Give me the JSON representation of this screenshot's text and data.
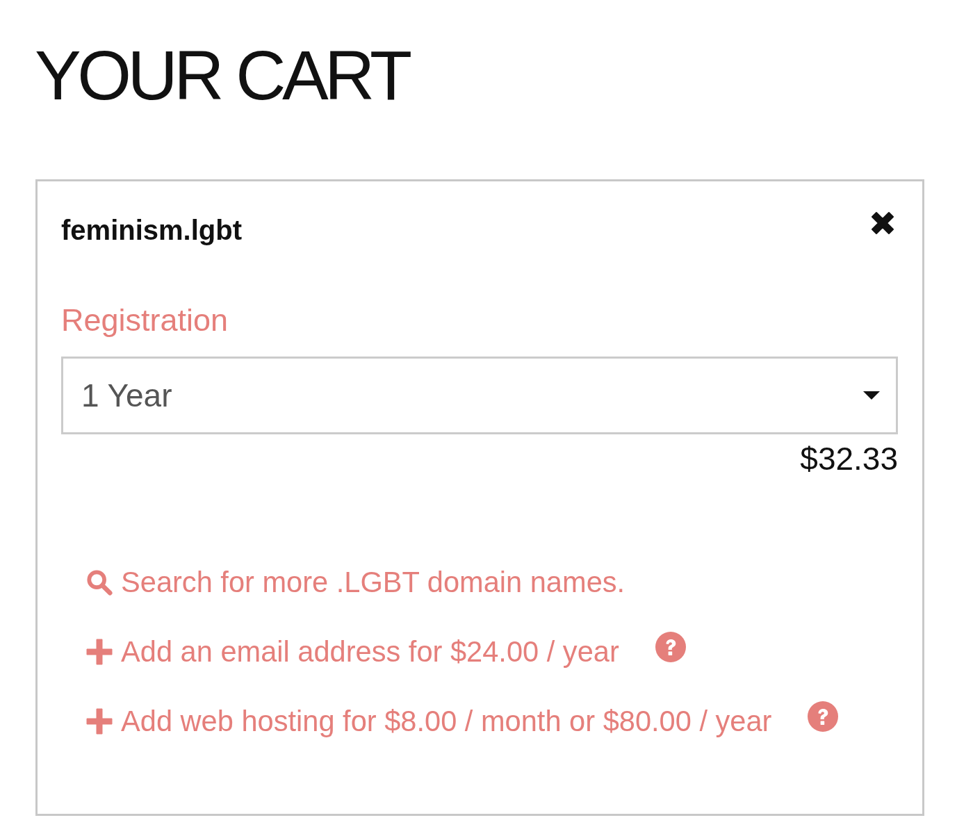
{
  "page": {
    "title": "YOUR CART"
  },
  "cart_item": {
    "domain": "feminism.lgbt",
    "registration_label": "Registration",
    "term": {
      "value": "1 Year"
    },
    "price": "$32.33",
    "links": [
      {
        "kind": "search",
        "text": "Search for more .LGBT domain names.",
        "help": false
      },
      {
        "kind": "add",
        "text": "Add an email address for $24.00 / year",
        "help": true
      },
      {
        "kind": "add",
        "text": "Add web hosting for $8.00 / month or $80.00 / year",
        "help": true
      }
    ]
  }
}
